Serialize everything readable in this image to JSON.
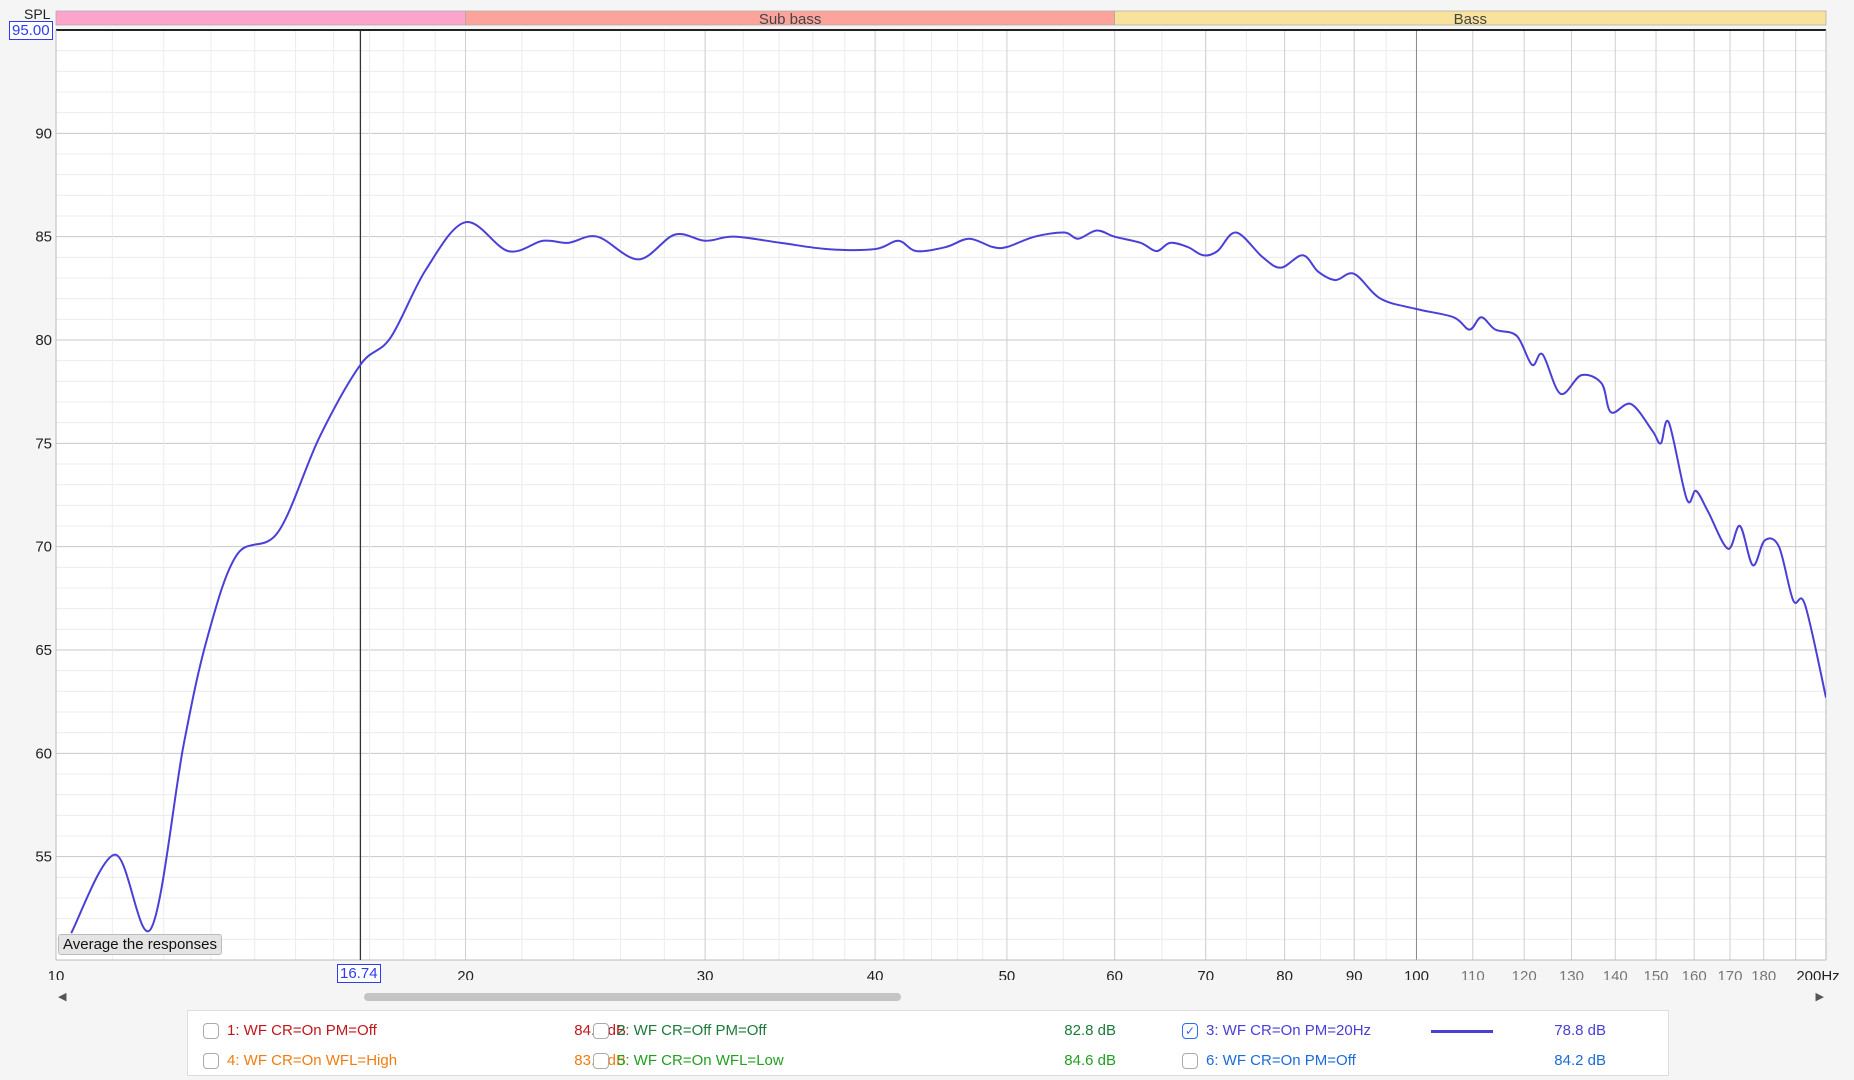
{
  "y_axis_label": "SPL",
  "y_max_value": "95.00",
  "cursor_value": "16.74",
  "average_button": "Average the responses",
  "bands": [
    {
      "label": "",
      "from": 10,
      "to": 20,
      "color": "#fca4cc"
    },
    {
      "label": "Sub bass",
      "from": 20,
      "to": 60,
      "color": "#fca49c"
    },
    {
      "label": "Bass",
      "from": 60,
      "to": 200,
      "color": "#f8e29c"
    }
  ],
  "legend": [
    {
      "label": "1: WF CR=On PM=Off",
      "value": "84.6 dB",
      "color": "#c0161c",
      "checked": false
    },
    {
      "label": "2: WF CR=Off PM=Off",
      "value": "82.8 dB",
      "color": "#1c7a3c",
      "checked": false
    },
    {
      "label": "3: WF CR=On PM=20Hz",
      "value": "78.8 dB",
      "color": "#4a40d8",
      "checked": true
    },
    {
      "label": "4: WF CR=On WFL=High",
      "value": "83.9 dB",
      "color": "#f07c10",
      "checked": false
    },
    {
      "label": "5: WF CR=On WFL=Low",
      "value": "84.6 dB",
      "color": "#20a020",
      "checked": false
    },
    {
      "label": "6: WF CR=On PM=Off",
      "value": "84.2 dB",
      "color": "#1c6cd8",
      "checked": false
    }
  ],
  "chart_data": {
    "type": "line",
    "xscale": "log",
    "xlim": [
      10,
      200
    ],
    "ylim": [
      50,
      95
    ],
    "ylabel": "SPL",
    "xunit": "Hz",
    "cursor_x": 16.74,
    "y_ticks": [
      "55",
      "60",
      "65",
      "70",
      "75",
      "80",
      "85",
      "90"
    ],
    "y_tick_values": [
      55,
      60,
      65,
      70,
      75,
      80,
      85,
      90
    ],
    "x_ticks": [
      {
        "v": 10,
        "label": "10",
        "minor": false
      },
      {
        "v": 20,
        "label": "20",
        "minor": false
      },
      {
        "v": 30,
        "label": "30",
        "minor": false
      },
      {
        "v": 40,
        "label": "40",
        "minor": false
      },
      {
        "v": 50,
        "label": "50",
        "minor": false
      },
      {
        "v": 60,
        "label": "60",
        "minor": false
      },
      {
        "v": 70,
        "label": "70",
        "minor": false
      },
      {
        "v": 80,
        "label": "80",
        "minor": false
      },
      {
        "v": 90,
        "label": "90",
        "minor": false
      },
      {
        "v": 100,
        "label": "100",
        "minor": false
      },
      {
        "v": 110,
        "label": "110",
        "minor": true
      },
      {
        "v": 120,
        "label": "120",
        "minor": true
      },
      {
        "v": 130,
        "label": "130",
        "minor": true
      },
      {
        "v": 140,
        "label": "140",
        "minor": true
      },
      {
        "v": 150,
        "label": "150",
        "minor": true
      },
      {
        "v": 160,
        "label": "160",
        "minor": true
      },
      {
        "v": 170,
        "label": "170",
        "minor": true
      },
      {
        "v": 180,
        "label": "180",
        "minor": true
      },
      {
        "v": 200,
        "label": "200Hz",
        "minor": false
      }
    ],
    "series": [
      {
        "name": "3: WF CR=On PM=20Hz",
        "color": "#4a40d8",
        "x": [
          10.26,
          11.05,
          11.74,
          12.41,
          12.92,
          13.58,
          14.56,
          15.62,
          16.74,
          17.61,
          18.7,
          20,
          21.5,
          22.8,
          23.8,
          25,
          26.8,
          28.5,
          30,
          31.5,
          34.1,
          36.9,
          40,
          41.6,
          42.9,
          45.1,
          46.9,
          48.8,
          50,
          52.4,
          55.1,
          56.4,
          58.2,
          60,
          62.7,
          64.4,
          65.9,
          67.9,
          69.7,
          71.4,
          73.7,
          77.1,
          79.5,
          82.5,
          84.7,
          87.2,
          90,
          94.1,
          100,
          106.5,
          109.4,
          111.6,
          114.3,
          118.5,
          121.6,
          123.8,
          127.6,
          132.2,
          136.8,
          139,
          143.8,
          149.1,
          151.2,
          153.3,
          158,
          160.5,
          163.8,
          169.4,
          172.9,
          176.7,
          180.3,
          184.7,
          189.2,
          193,
          200
        ],
        "y": [
          51.3,
          55.1,
          51.5,
          60.4,
          65.6,
          69.6,
          70.7,
          75.3,
          78.8,
          80.1,
          83.4,
          85.7,
          84.3,
          84.8,
          84.7,
          85.0,
          83.9,
          85.1,
          84.8,
          85.0,
          84.7,
          84.4,
          84.4,
          84.8,
          84.3,
          84.5,
          84.9,
          84.5,
          84.5,
          85.0,
          85.2,
          84.9,
          85.3,
          85.0,
          84.7,
          84.3,
          84.7,
          84.5,
          84.1,
          84.3,
          85.2,
          84.0,
          83.5,
          84.1,
          83.3,
          82.9,
          83.2,
          82.0,
          81.5,
          81.1,
          80.5,
          81.1,
          80.5,
          80.2,
          78.8,
          79.3,
          77.4,
          78.3,
          77.9,
          76.5,
          76.9,
          75.6,
          75.0,
          76.0,
          72.3,
          72.7,
          71.7,
          69.9,
          71.0,
          69.1,
          70.3,
          70.0,
          67.4,
          67.2,
          62.7
        ]
      }
    ]
  }
}
